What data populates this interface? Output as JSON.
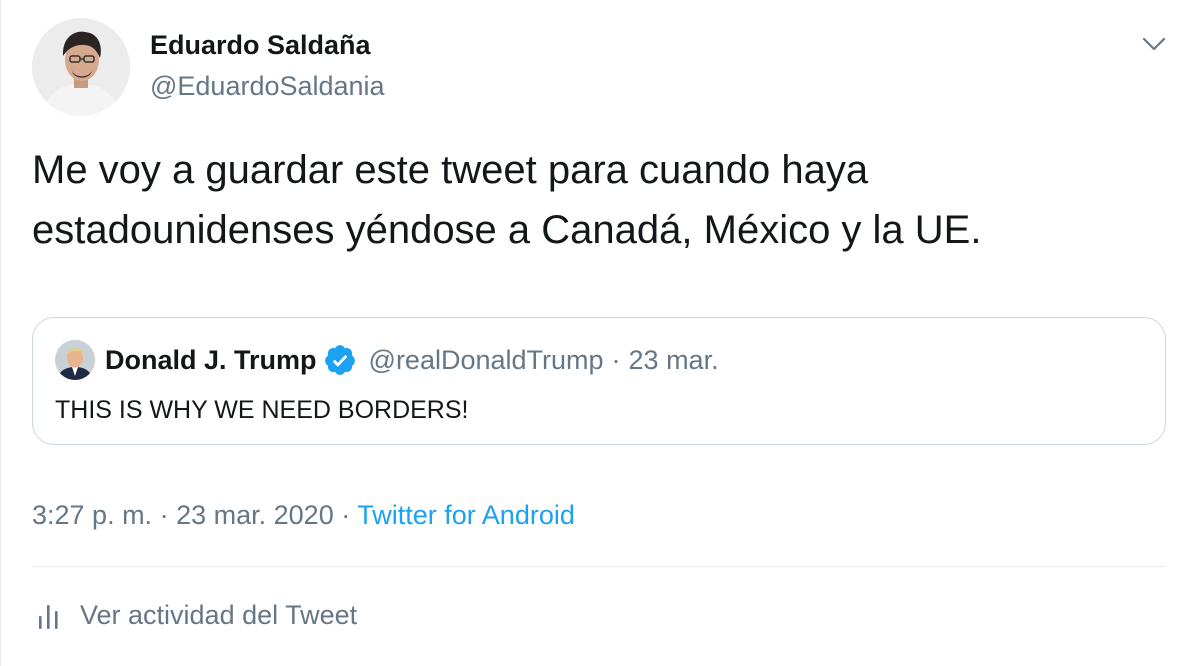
{
  "author": {
    "name": "Eduardo Saldaña",
    "handle": "@EduardoSaldania"
  },
  "tweet": {
    "line1": "Me voy a guardar este tweet para cuando haya",
    "line2": "estadounidenses yéndose a Canadá, México y la UE."
  },
  "quoted": {
    "name": "Donald J. Trump",
    "handle": "@realDonaldTrump",
    "separator": "·",
    "date": "23 mar.",
    "text": "THIS IS WHY WE NEED BORDERS!"
  },
  "meta": {
    "time": "3:27 p. m.",
    "separator": "·",
    "date": "23 mar. 2020",
    "source": "Twitter for Android"
  },
  "activity": {
    "label": "Ver actividad del Tweet"
  },
  "colors": {
    "link": "#1da1f2",
    "secondary_text": "#657786",
    "primary_text": "#14171a",
    "border": "#ccd6dd"
  },
  "icons": {
    "menu": "chevron-down-icon",
    "verified": "verified-badge-icon",
    "activity": "bar-chart-icon"
  }
}
